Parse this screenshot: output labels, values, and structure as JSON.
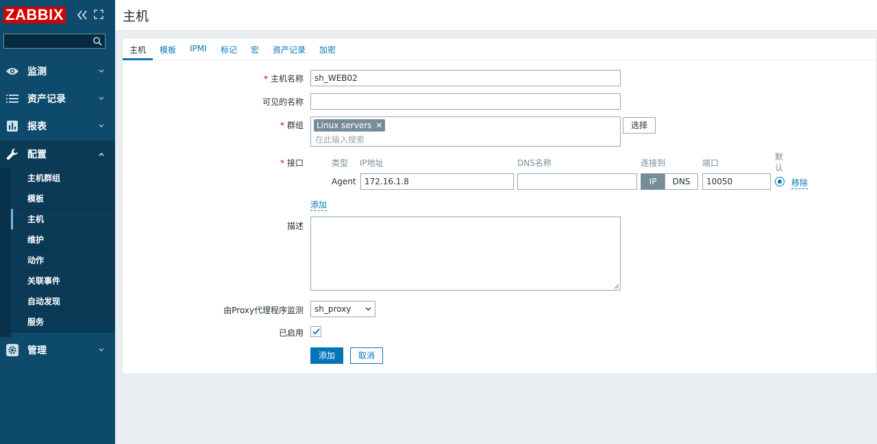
{
  "app": {
    "logo": "ZABBIX",
    "collapse_icon": "double-chevron-left-icon",
    "kiosk_icon": "fullscreen-icon"
  },
  "sidebar": {
    "search": {
      "value": "",
      "placeholder": ""
    },
    "menu": [
      {
        "label": "监测",
        "icon": "eye-icon"
      },
      {
        "label": "资产记录",
        "icon": "list-icon"
      },
      {
        "label": "报表",
        "icon": "bar-chart-icon"
      },
      {
        "label": "配置",
        "icon": "wrench-icon"
      },
      {
        "label": "管理",
        "icon": "gear-icon"
      }
    ],
    "submenu": [
      {
        "label": "主机群组"
      },
      {
        "label": "模板"
      },
      {
        "label": "主机"
      },
      {
        "label": "维护"
      },
      {
        "label": "动作"
      },
      {
        "label": "关联事件"
      },
      {
        "label": "自动发现"
      },
      {
        "label": "服务"
      }
    ]
  },
  "header": {
    "title": "主机"
  },
  "tabs": [
    {
      "label": "主机"
    },
    {
      "label": "模板"
    },
    {
      "label": "IPMI"
    },
    {
      "label": "标记"
    },
    {
      "label": "宏"
    },
    {
      "label": "资产记录"
    },
    {
      "label": "加密"
    }
  ],
  "form": {
    "required_mark": "*",
    "host_name": {
      "label": "主机名称",
      "value": "sh_WEB02"
    },
    "visible_name": {
      "label": "可见的名称",
      "value": ""
    },
    "groups": {
      "label": "群组",
      "chip": "Linux servers",
      "placeholder": "在此输入搜索",
      "select_button": "选择"
    },
    "interfaces": {
      "label": "接口",
      "headers": {
        "type": "类型",
        "ip": "IP地址",
        "dns": "DNS名称",
        "connect_to": "连接到",
        "port": "端口",
        "default": "默认"
      },
      "row": {
        "type": "Agent",
        "ip": "172.16.1.8",
        "dns": "",
        "connect_ip": "IP",
        "connect_dns": "DNS",
        "port": "10050",
        "remove": "移除"
      },
      "add_link": "添加"
    },
    "description": {
      "label": "描述",
      "value": ""
    },
    "proxy": {
      "label": "由Proxy代理程序监测",
      "value": "sh_proxy"
    },
    "enabled": {
      "label": "已启用",
      "checked": true
    },
    "buttons": {
      "add": "添加",
      "cancel": "取消"
    }
  },
  "colors": {
    "sidebar": "#0e4a6b",
    "accent": "#0275b8",
    "logo_red": "#d40000",
    "required": "#d40000"
  }
}
